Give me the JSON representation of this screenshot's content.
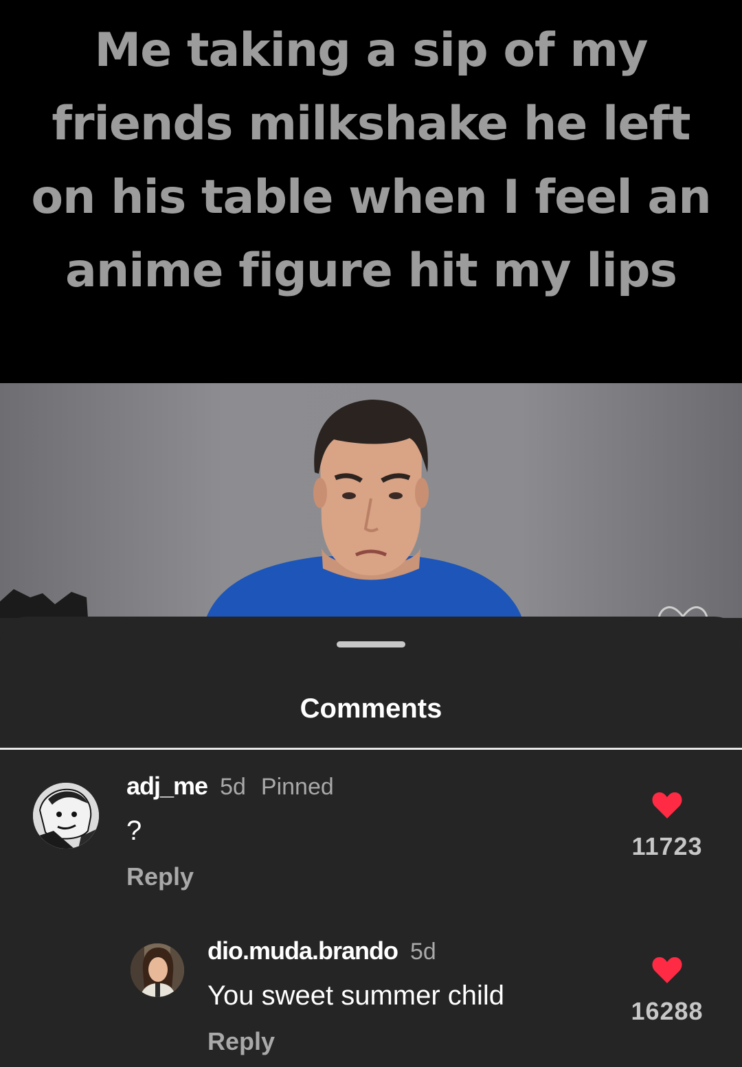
{
  "video": {
    "caption": "Me taking a sip of my friends milkshake he left on his table when I feel an anime figure hit my lips"
  },
  "comments_sheet": {
    "title": "Comments",
    "comments": [
      {
        "username": "adj_me",
        "time": "5d",
        "pinned": "Pinned",
        "text": "?",
        "reply_label": "Reply",
        "likes": "11723"
      },
      {
        "username": "dio.muda.brando",
        "time": "5d",
        "text": "You sweet summer child",
        "reply_label": "Reply",
        "likes": "16288"
      }
    ]
  },
  "colors": {
    "sheet_background": "#252525",
    "like_heart": "#ff2a43",
    "muted_text": "#a9a9a9"
  },
  "icons": {
    "like": "heart-icon",
    "video_like": "heart-outline-icon"
  }
}
